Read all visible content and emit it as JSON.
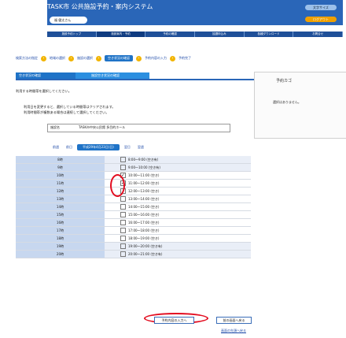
{
  "header": {
    "title": "TASK市 公共施設予約・案内システム",
    "user": "福 健太さん",
    "top_right_1": "文字サイズ",
    "top_right_2": "ログアウト"
  },
  "nav": [
    "施設予約トップ",
    "施設案内・予約",
    "予約の確認",
    "抽選申込み",
    "各種ダウンロード",
    "お問合せ"
  ],
  "steps": [
    "検索方法の指定",
    "地域の選択",
    "施設の選択",
    "空き状況の確認",
    "予約内容の入力",
    "予約完了"
  ],
  "tabs": {
    "left": "空き状況の確認",
    "right": "施設空き状況の確認"
  },
  "notice_title": "利用する時間帯を選択してください。",
  "info": [
    "利用日を変更すると、選択している時間帯はクリアされます。",
    "利用時間帯が複数ある場合は連続して選択してください。"
  ],
  "facility": {
    "label": "施設名",
    "value": "TASK市中央公民館 多目的ホール"
  },
  "right_panel": {
    "title": "予約カゴ",
    "message": "選択はありません。"
  },
  "date_nav": {
    "prev_week": "前週",
    "prev_day": "前日",
    "current": "平成29年4月23日(日)",
    "next_day": "翌日",
    "next_week": "翌週"
  },
  "rows": [
    {
      "name": "8時",
      "slot": "8:00〜9:00",
      "status": "(空き有)",
      "checked": false
    },
    {
      "name": "9時",
      "slot": "9:00〜10:00",
      "status": "(空き有)",
      "checked": false
    },
    {
      "name": "10時",
      "slot": "10:00〜11:00",
      "status": "(空き)",
      "checked": true
    },
    {
      "name": "11時",
      "slot": "11:00〜12:00",
      "status": "(空き)",
      "checked": true
    },
    {
      "name": "12時",
      "slot": "12:00〜13:00",
      "status": "(空き)",
      "checked": false
    },
    {
      "name": "13時",
      "slot": "13:00〜14:00",
      "status": "(空き)",
      "checked": false
    },
    {
      "name": "14時",
      "slot": "14:00〜15:00",
      "status": "(空き)",
      "checked": false
    },
    {
      "name": "15時",
      "slot": "15:00〜16:00",
      "status": "(空き)",
      "checked": false
    },
    {
      "name": "16時",
      "slot": "16:00〜17:00",
      "status": "(空き)",
      "checked": false
    },
    {
      "name": "17時",
      "slot": "17:00〜18:00",
      "status": "(空き)",
      "checked": false
    },
    {
      "name": "18時",
      "slot": "18:00〜19:00",
      "status": "(空き)",
      "checked": false
    },
    {
      "name": "19時",
      "slot": "19:00〜20:00",
      "status": "(空き有)",
      "checked": false
    },
    {
      "name": "20時",
      "slot": "20:00〜21:00",
      "status": "(空き有)",
      "checked": false
    }
  ],
  "buttons": {
    "main": "予約内容の入力へ",
    "back": "前の画面へ戻る"
  },
  "link": "画面の先頭へ戻る"
}
